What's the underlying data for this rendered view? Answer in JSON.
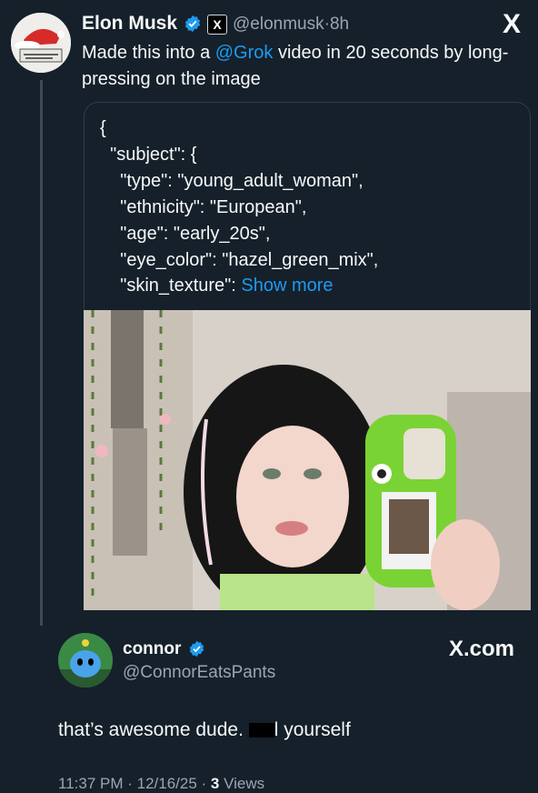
{
  "tweet": {
    "author_name": "Elon Musk",
    "handle": "@elonmusk",
    "separator": "·",
    "time": "8h",
    "x_badge": "X",
    "close_glyph": "X",
    "text_before_link": "Made this into a ",
    "link_text": "@Grok",
    "text_after_link": " video in 20 seconds by long-pressing on the image",
    "code_lines": [
      "{",
      "  \"subject\": {",
      "    \"type\": \"young_adult_woman\",",
      "    \"ethnicity\": \"European\",",
      "    \"age\": \"early_20s\",",
      "    \"eye_color\": \"hazel_green_mix\","
    ],
    "code_last_prefix": "    \"skin_texture\": ",
    "show_more": "Show more"
  },
  "reply": {
    "author_name": "connor",
    "handle": "@ConnorEatsPants",
    "brand": "X.com",
    "text_before": "that’s awesome dude. ",
    "text_censored_suffix": "l yourself",
    "meta_time": "11:37 PM · 12/16/25 · ",
    "views_count": "3",
    "views_label": " Views"
  },
  "colors": {
    "background": "#15202b",
    "link": "#1d9bf0",
    "muted": "#9aa6b2",
    "verified": "#1d9bf0"
  },
  "icons": {
    "verified": "verified-badge-icon",
    "close": "x-logo-icon"
  }
}
